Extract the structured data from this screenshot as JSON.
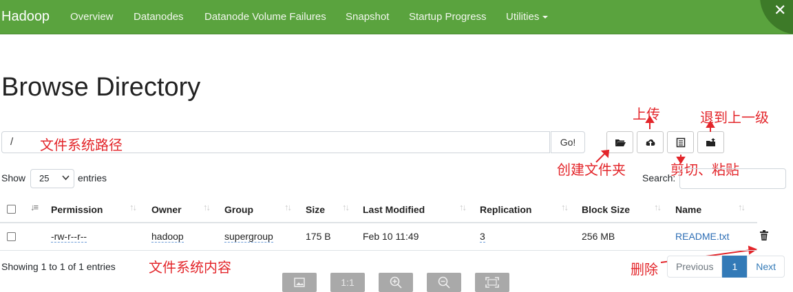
{
  "navbar": {
    "brand": "Hadoop",
    "items": [
      "Overview",
      "Datanodes",
      "Datanode Volume Failures",
      "Snapshot",
      "Startup Progress",
      "Utilities"
    ]
  },
  "page_title": "Browse Directory",
  "path_input": {
    "value": "/"
  },
  "go_button": "Go!",
  "length": {
    "show": "Show",
    "value": "25",
    "entries": "entries"
  },
  "search": {
    "label": "Search:"
  },
  "table": {
    "columns": [
      "Permission",
      "Owner",
      "Group",
      "Size",
      "Last Modified",
      "Replication",
      "Block Size",
      "Name"
    ],
    "rows": [
      {
        "permission": "-rw-r--r--",
        "owner": "hadoop",
        "group": "supergroup",
        "size": "175 B",
        "last_modified": "Feb 10 11:49",
        "replication": "3",
        "block_size": "256 MB",
        "name": "README.txt"
      }
    ]
  },
  "info": "Showing 1 to 1 of 1 entries",
  "pagination": {
    "previous": "Previous",
    "current": "1",
    "next": "Next"
  },
  "viewer": {
    "one_to_one": "1:1"
  },
  "annotations": {
    "path": "文件系统路径",
    "upload": "上传",
    "go_up": "退到上一级",
    "create_folder": "创建文件夹",
    "cut_paste": "剪切、粘贴",
    "fs_content": "文件系统内容",
    "delete": "删除"
  },
  "colors": {
    "navbar": "#5aa33e",
    "annotation": "#e3252a",
    "link": "#2c6db5",
    "active_page": "#337ab7"
  },
  "icons": [
    "folder-icon",
    "upload-icon",
    "clipboard-icon",
    "folder-up-icon",
    "trash-icon",
    "sort-icon",
    "close-icon"
  ]
}
